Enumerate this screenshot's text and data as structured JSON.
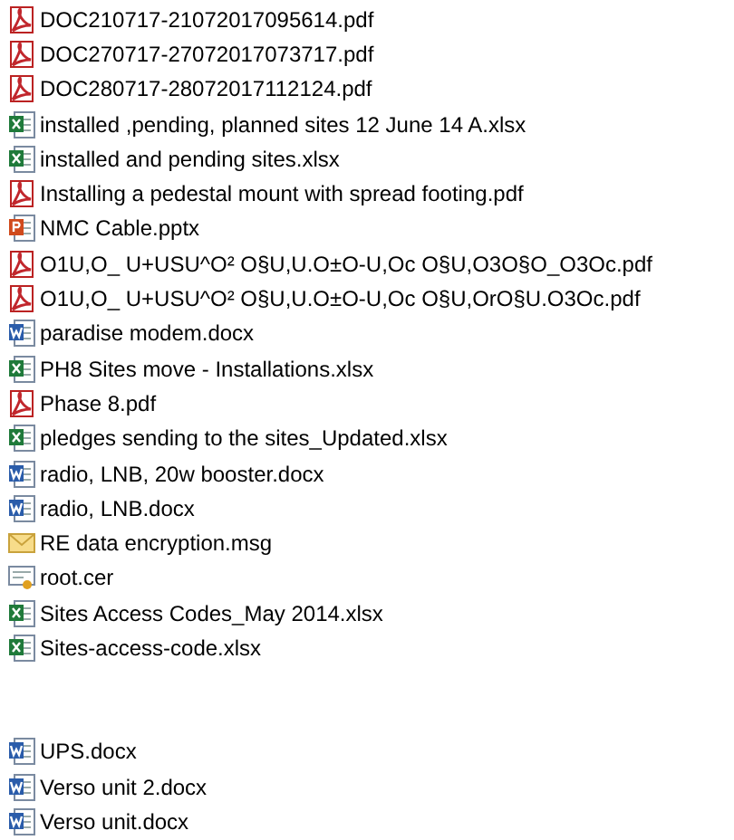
{
  "file_groups": [
    [
      {
        "name": "DOC210717-21072017095614.pdf",
        "kind": "pdf"
      },
      {
        "name": "DOC270717-27072017073717.pdf",
        "kind": "pdf"
      },
      {
        "name": "DOC280717-28072017112124.pdf",
        "kind": "pdf"
      },
      {
        "name": "installed ,pending, planned sites 12 June 14 A.xlsx",
        "kind": "xlsx"
      },
      {
        "name": "installed and pending sites.xlsx",
        "kind": "xlsx"
      },
      {
        "name": "Installing a pedestal mount with spread footing.pdf",
        "kind": "pdf"
      },
      {
        "name": "NMC Cable.pptx",
        "kind": "pptx"
      },
      {
        "name": "O1U,O_ U+USU^O² O§U,U.O±O-U,Oc O§U,O3O§O_O3Oc.pdf",
        "kind": "pdf"
      },
      {
        "name": "O1U,O_ U+USU^O² O§U,U.O±O-U,Oc O§U,OrO§U.O3Oc.pdf",
        "kind": "pdf"
      },
      {
        "name": "paradise modem.docx",
        "kind": "docx"
      },
      {
        "name": "PH8 Sites move - Installations.xlsx",
        "kind": "xlsx"
      },
      {
        "name": "Phase 8.pdf",
        "kind": "pdf"
      },
      {
        "name": "pledges sending to the sites_Updated.xlsx",
        "kind": "xlsx"
      },
      {
        "name": "radio, LNB, 20w booster.docx",
        "kind": "docx"
      },
      {
        "name": "radio, LNB.docx",
        "kind": "docx"
      },
      {
        "name": "RE data encryption.msg",
        "kind": "msg"
      },
      {
        "name": "root.cer",
        "kind": "cer"
      },
      {
        "name": "Sites Access Codes_May 2014.xlsx",
        "kind": "xlsx"
      },
      {
        "name": "Sites-access-code.xlsx",
        "kind": "xlsx"
      }
    ],
    [
      {
        "name": "UPS.docx",
        "kind": "docx"
      },
      {
        "name": "Verso unit 2.docx",
        "kind": "docx"
      },
      {
        "name": "Verso unit.docx",
        "kind": "docx"
      }
    ]
  ]
}
